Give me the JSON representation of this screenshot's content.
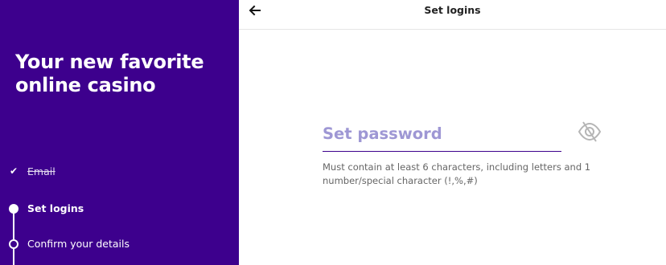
{
  "sidebar": {
    "title": "Your new favorite online casino",
    "steps": [
      {
        "label": "Email",
        "status": "completed",
        "icon": "check-icon"
      },
      {
        "label": "Set logins",
        "status": "current",
        "icon": "filled-circle-icon"
      },
      {
        "label": "Confirm your details",
        "status": "upcoming",
        "icon": "hollow-circle-icon"
      }
    ],
    "background_color": "#3d008d"
  },
  "header": {
    "title": "Set logins",
    "back_icon": "back-arrow-icon"
  },
  "form": {
    "password": {
      "placeholder": "Set password",
      "value": "",
      "toggle_icon": "eye-slash-icon"
    },
    "helper_text": "Must contain at least 6 characters, including letters and 1 number/special character (!,%,#)"
  },
  "colors": {
    "accent": "#3d008d",
    "placeholder": "#9e97d4"
  }
}
